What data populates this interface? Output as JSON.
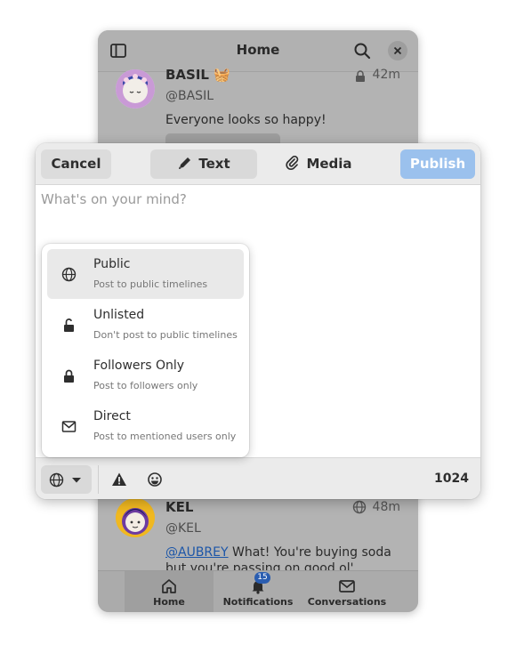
{
  "app": {
    "title": "Home"
  },
  "timeline": [
    {
      "name": "BASIL 🧺",
      "handle": "@BASIL",
      "time": "42m",
      "text": "Everyone looks so happy!"
    },
    {
      "name": "KEL",
      "handle": "@KEL",
      "time": "48m",
      "mention": "@AUBREY",
      "text": " What! You're buying soda but you're passing on good ol' ORANGE"
    }
  ],
  "bottom_nav": {
    "items": [
      {
        "label": "Home",
        "icon": "home-icon"
      },
      {
        "label": "Notifications",
        "icon": "bell-icon",
        "badge": "15"
      },
      {
        "label": "Conversations",
        "icon": "mail-icon"
      }
    ]
  },
  "composer": {
    "cancel_label": "Cancel",
    "text_tab_label": "Text",
    "media_tab_label": "Media",
    "publish_label": "Publish",
    "placeholder": "What's on your mind?",
    "char_count": "1024",
    "accent_color": "#9bc1ed"
  },
  "visibility_menu": {
    "options": [
      {
        "title": "Public",
        "desc": "Post to public timelines",
        "icon": "globe-icon",
        "selected": true
      },
      {
        "title": "Unlisted",
        "desc": "Don't post to public timelines",
        "icon": "unlocked-icon"
      },
      {
        "title": "Followers Only",
        "desc": "Post to followers only",
        "icon": "lock-icon"
      },
      {
        "title": "Direct",
        "desc": "Post to mentioned users only",
        "icon": "envelope-icon"
      }
    ]
  }
}
